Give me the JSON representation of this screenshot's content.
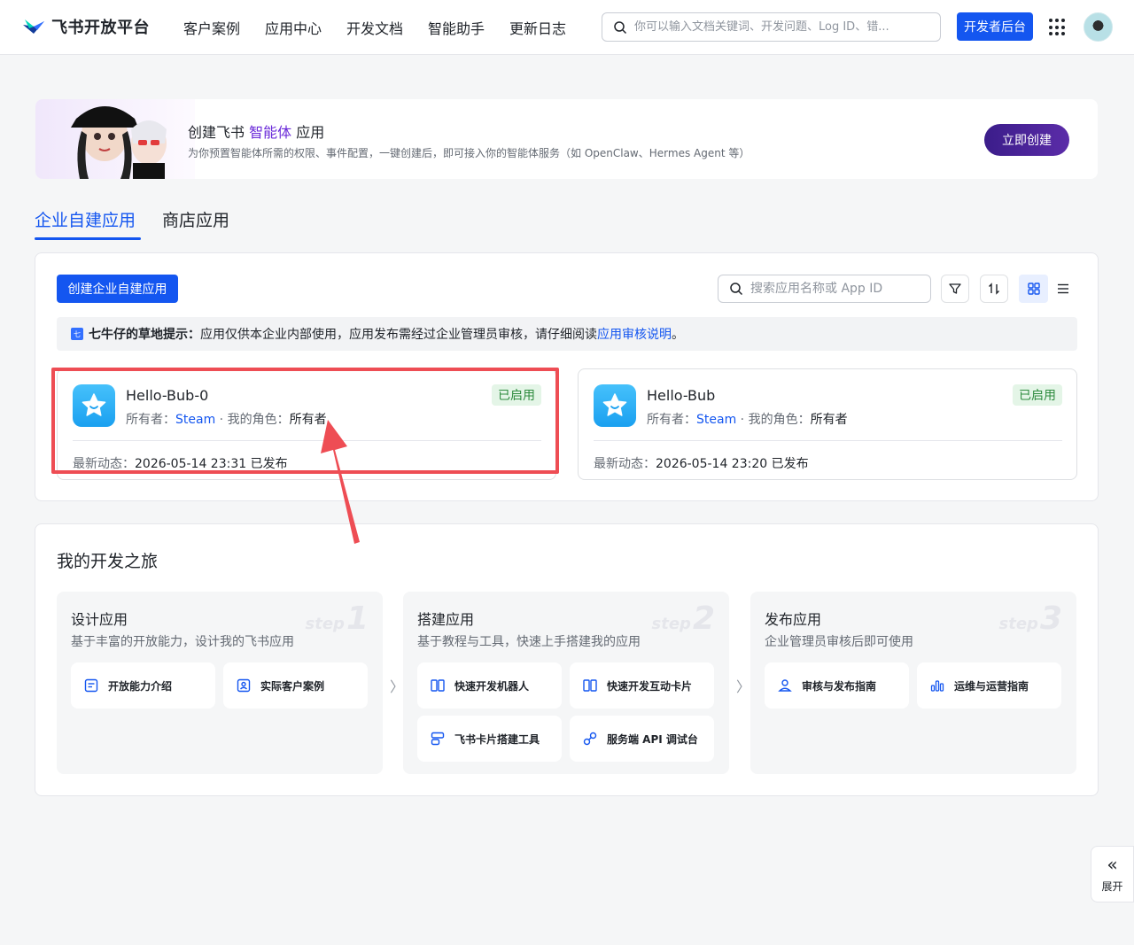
{
  "nav": {
    "brand": "飞书开放平台",
    "items": [
      {
        "label": "客户案例"
      },
      {
        "label": "应用中心"
      },
      {
        "label": "开发文档"
      },
      {
        "label": "智能助手"
      },
      {
        "label": "更新日志"
      }
    ],
    "search_placeholder": "你可以输入文档关键词、开发问题、Log ID、错...",
    "dev_console": "开发者后台"
  },
  "banner": {
    "title_prefix": "创建飞书 ",
    "title_accent": "智能体",
    "title_suffix": " 应用",
    "desc": "为你预置智能体所需的权限、事件配置，一键创建后，即可接入你的智能体服务（如 OpenClaw、Hermes Agent 等）",
    "cta": "立即创建"
  },
  "tabs": {
    "active": "企业自建应用",
    "inactive": "商店应用"
  },
  "apps_panel": {
    "create_btn": "创建企业自建应用",
    "search_placeholder": "搜索应用名称或 App ID",
    "notice": {
      "icon_text": "七",
      "title": "七牛仔的草地提示：",
      "text": "应用仅供本企业内部使用，应用发布需经过企业管理员审核，请仔细阅读 ",
      "link": "应用审核说明",
      "end": "。"
    },
    "apps": [
      {
        "name": "Hello-Bub-0",
        "status": "已启用",
        "owner_label": "所有者：",
        "owner": "Steam",
        "sep": " · ",
        "role_label": "我的角色：",
        "role": "所有者",
        "latest_label": "最新动态：",
        "latest": "2026-05-14 23:31 已发布"
      },
      {
        "name": "Hello-Bub",
        "status": "已启用",
        "owner_label": "所有者：",
        "owner": "Steam",
        "sep": " · ",
        "role_label": "我的角色：",
        "role": "所有者",
        "latest_label": "最新动态：",
        "latest": "2026-05-14 23:20 已发布"
      }
    ]
  },
  "journey": {
    "title": "我的开发之旅",
    "steps": [
      {
        "title": "设计应用",
        "desc": "基于丰富的开放能力，设计我的飞书应用",
        "mark_word": "step",
        "mark_num": "1",
        "buttons": [
          {
            "label": "开放能力介绍"
          },
          {
            "label": "实际客户案例"
          }
        ]
      },
      {
        "title": "搭建应用",
        "desc": "基于教程与工具，快速上手搭建我的应用",
        "mark_word": "step",
        "mark_num": "2",
        "buttons": [
          {
            "label": "快速开发机器人"
          },
          {
            "label": "快速开发互动卡片"
          },
          {
            "label": "飞书卡片搭建工具"
          },
          {
            "label": "服务端 API 调试台"
          }
        ]
      },
      {
        "title": "发布应用",
        "desc": "企业管理员审核后即可使用",
        "mark_word": "step",
        "mark_num": "3",
        "buttons": [
          {
            "label": "审核与发布指南"
          },
          {
            "label": "运维与运营指南"
          }
        ]
      }
    ],
    "arrow": "〉"
  },
  "expand": {
    "chevron": "«",
    "label": "展开"
  },
  "colors": {
    "primary": "#1456f0",
    "highlight": "#ee4d54",
    "badge_bg": "#e4f5e7",
    "badge_text": "#2e8b3e"
  }
}
